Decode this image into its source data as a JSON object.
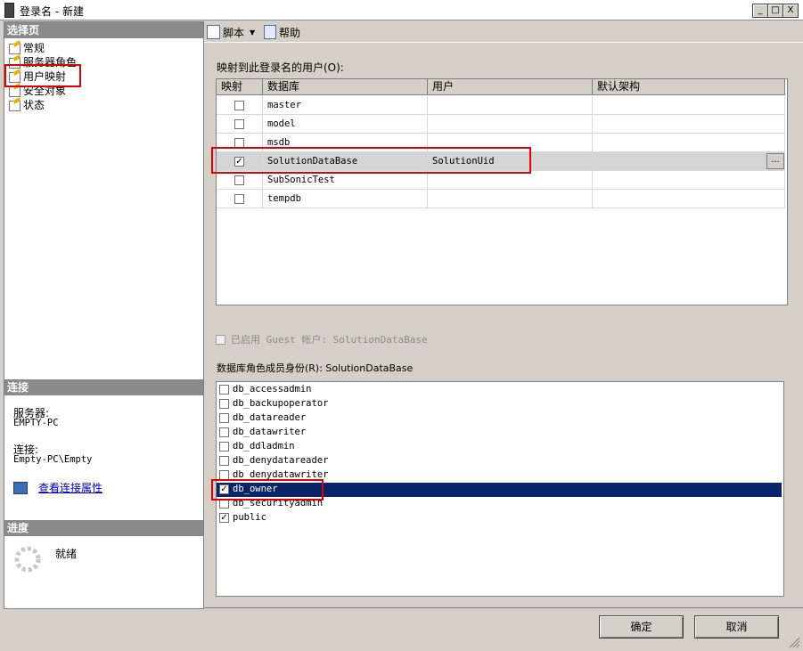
{
  "window": {
    "title": "登录名 - 新建",
    "controls": [
      "_",
      "□",
      "X"
    ]
  },
  "left": {
    "select_page_header": "选择页",
    "pages": [
      {
        "label": "常规"
      },
      {
        "label": "服务器角色"
      },
      {
        "label": "用户映射"
      },
      {
        "label": "安全对象"
      },
      {
        "label": "状态"
      }
    ],
    "connection_header": "连接",
    "server_label": "服务器:",
    "server_value": "EMPTY-PC",
    "connect_label": "连接:",
    "connect_value": "Empty-PC\\Empty",
    "view_props_link": "查看连接属性",
    "progress_header": "进度",
    "progress_status": "就绪"
  },
  "toolbar": {
    "script_label": "脚本",
    "help_label": "帮助"
  },
  "mapping": {
    "label": "映射到此登录名的用户(O):",
    "columns": [
      "映射",
      "数据库",
      "用户",
      "默认架构"
    ],
    "rows": [
      {
        "mapped": false,
        "database": "master",
        "user": "",
        "schema": ""
      },
      {
        "mapped": false,
        "database": "model",
        "user": "",
        "schema": ""
      },
      {
        "mapped": false,
        "database": "msdb",
        "user": "",
        "schema": ""
      },
      {
        "mapped": true,
        "database": "SolutionDataBase",
        "user": "SolutionUid",
        "schema": ""
      },
      {
        "mapped": false,
        "database": "SubSonicTest",
        "user": "",
        "schema": ""
      },
      {
        "mapped": false,
        "database": "tempdb",
        "user": "",
        "schema": ""
      }
    ],
    "ellipsis": "..."
  },
  "guest": {
    "label": "已启用 Guest 帐户: SolutionDataBase",
    "checked": false
  },
  "roles": {
    "label": "数据库角色成员身份(R): SolutionDataBase",
    "items": [
      {
        "name": "db_accessadmin",
        "checked": false
      },
      {
        "name": "db_backupoperator",
        "checked": false
      },
      {
        "name": "db_datareader",
        "checked": false
      },
      {
        "name": "db_datawriter",
        "checked": false
      },
      {
        "name": "db_ddladmin",
        "checked": false
      },
      {
        "name": "db_denydatareader",
        "checked": false
      },
      {
        "name": "db_denydatawriter",
        "checked": false
      },
      {
        "name": "db_owner",
        "checked": true
      },
      {
        "name": "db_securityadmin",
        "checked": false
      },
      {
        "name": "public",
        "checked": true
      }
    ]
  },
  "buttons": {
    "ok": "确定",
    "cancel": "取消"
  },
  "colors": {
    "selected_row": "#0a246a",
    "highlight": "#e00000",
    "section_header": "#8a8a8a"
  }
}
